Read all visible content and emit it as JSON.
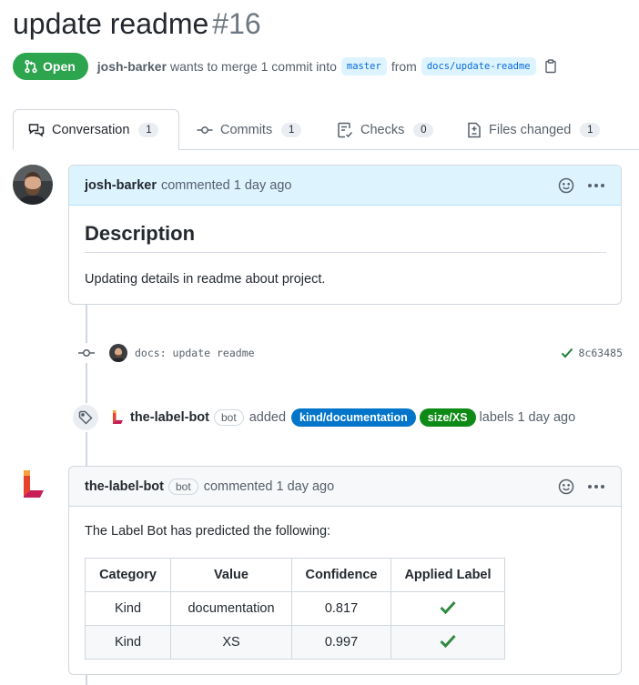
{
  "pr": {
    "title": "update readme",
    "number": "#16",
    "state": "Open",
    "author": "josh-barker",
    "summary": "wants to merge 1 commit into",
    "base_branch": "master",
    "from_word": "from",
    "head_branch": "docs/update-readme"
  },
  "tabs": [
    {
      "label": "Conversation",
      "count": "1",
      "icon": "comment-discussion-icon"
    },
    {
      "label": "Commits",
      "count": "1",
      "icon": "git-commit-icon"
    },
    {
      "label": "Checks",
      "count": "0",
      "icon": "checklist-icon"
    },
    {
      "label": "Files changed",
      "count": "1",
      "icon": "file-diff-icon"
    }
  ],
  "first_comment": {
    "author": "josh-barker",
    "action": "commented 1 day ago",
    "heading": "Description",
    "body": "Updating details in readme about project."
  },
  "commit": {
    "message": "docs: update readme",
    "sha": "8c63485",
    "status": "success"
  },
  "label_event": {
    "actor": "the-label-bot",
    "bot_badge": "bot",
    "verb": "added",
    "labels": [
      {
        "name": "kind/documentation",
        "color": "#0075ca"
      },
      {
        "name": "size/XS",
        "color": "#0e8a16"
      }
    ],
    "suffix": "labels 1 day ago"
  },
  "bot_comment": {
    "author": "the-label-bot",
    "bot_badge": "bot",
    "action": "commented 1 day ago",
    "intro": "The Label Bot has predicted the following:",
    "table": {
      "headers": [
        "Category",
        "Value",
        "Confidence",
        "Applied Label"
      ],
      "rows": [
        {
          "category": "Kind",
          "value": "documentation",
          "confidence": "0.817",
          "applied": "check"
        },
        {
          "category": "Kind",
          "value": "XS",
          "confidence": "0.997",
          "applied": "check"
        }
      ]
    }
  },
  "colors": {
    "open_green": "#2da44e",
    "link_blue": "#0969da",
    "check_green": "#1a7f37"
  }
}
